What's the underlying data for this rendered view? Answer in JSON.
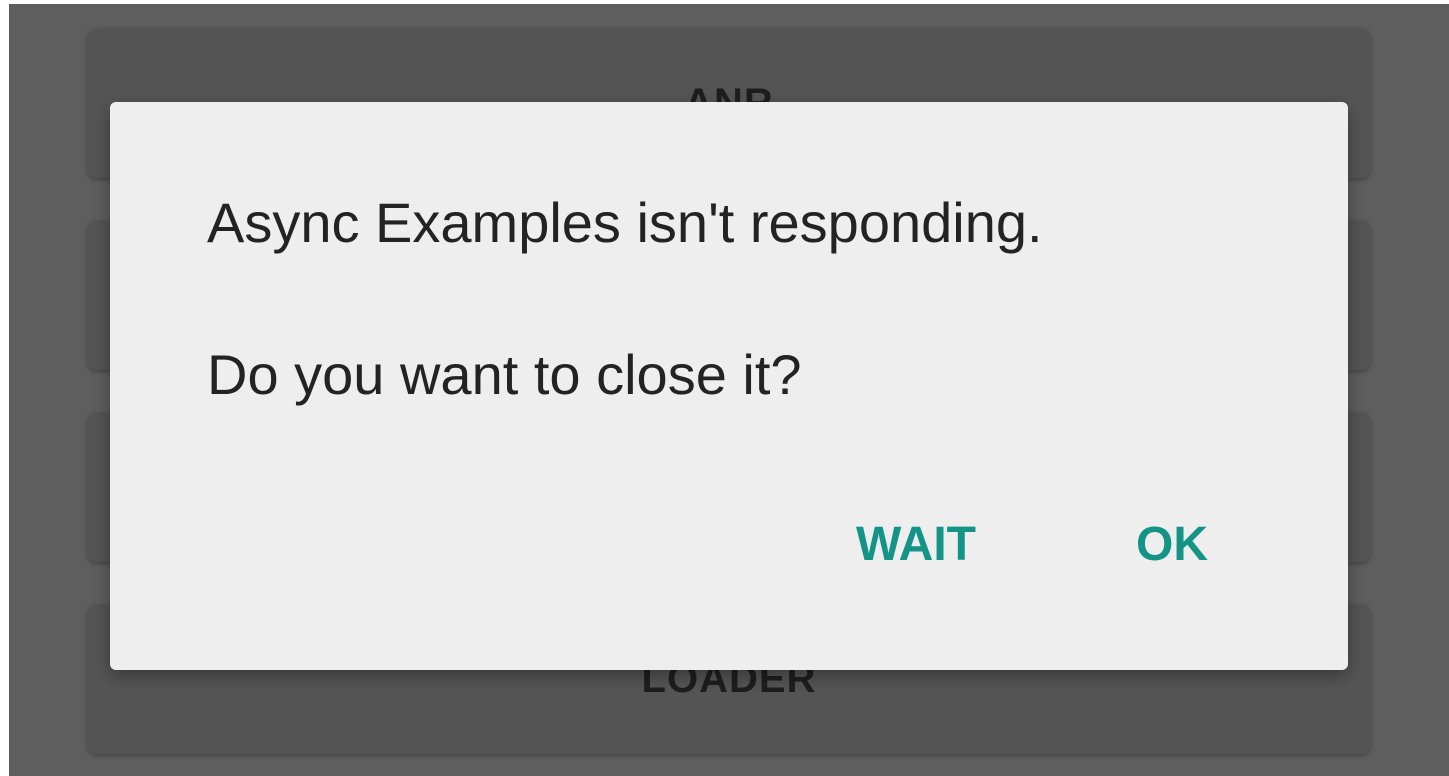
{
  "background": {
    "buttons": [
      "ANR",
      "",
      "",
      "LOADER"
    ]
  },
  "dialog": {
    "title": "Async Examples isn't responding.",
    "message": "Do you want to close it?",
    "wait_label": "WAIT",
    "ok_label": "OK"
  },
  "colors": {
    "accent": "#139487",
    "scrim": "#5e5e5e",
    "dialog_bg": "#eeeeee"
  }
}
